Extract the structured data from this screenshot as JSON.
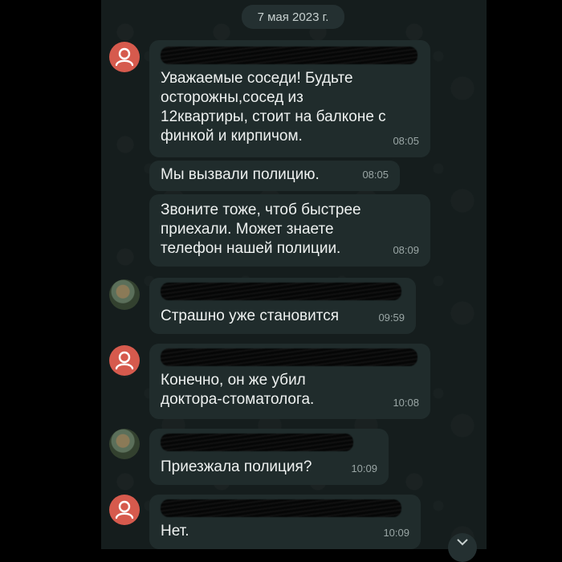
{
  "date_label": "7 мая 2023 г.",
  "messages": [
    {
      "text": "Уважаемые соседи! Будьте\nосторожны,сосед из\n12квартиры, стоит на балконе с\nфинкой и кирпичом.",
      "time": "08:05"
    },
    {
      "text": "Мы вызвали полицию.",
      "time": "08:05"
    },
    {
      "text": "Звоните тоже, чтоб быстрее\nприехали. Может знаете\nтелефон нашей полиции.",
      "time": "08:09"
    },
    {
      "text": "Страшно уже становится",
      "time": "09:59"
    },
    {
      "text": "Конечно, он же убил\nдоктора-стоматолога.",
      "time": "10:08"
    },
    {
      "text": "Приезжала полиция?",
      "time": "10:09"
    },
    {
      "text": "Нет.",
      "time": "10:09"
    }
  ],
  "colors": {
    "avatar_default": "#d65a4d",
    "bubble": "#202c2c",
    "chat_bg": "#151d1d"
  },
  "icons": {
    "default_avatar": "person-icon",
    "scroll_down": "chevron-down-icon"
  }
}
